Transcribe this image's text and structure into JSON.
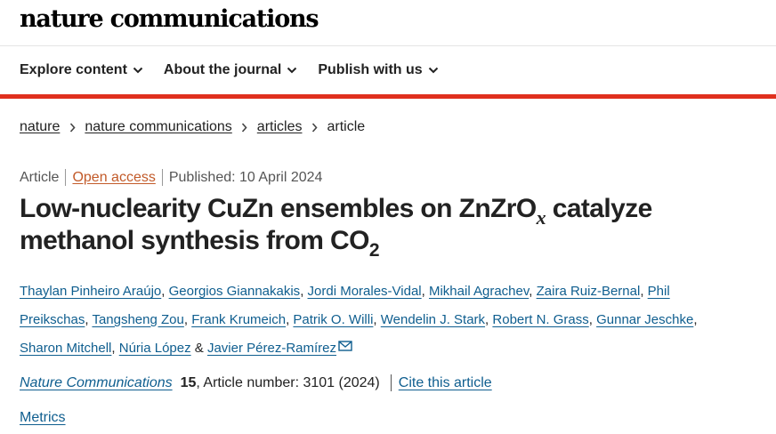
{
  "site": {
    "brand": "nature communications"
  },
  "nav": {
    "items": [
      {
        "label": "Explore content",
        "icon": "chevron-down-icon"
      },
      {
        "label": "About the journal",
        "icon": "chevron-down-icon"
      },
      {
        "label": "Publish with us",
        "icon": "chevron-down-icon"
      }
    ]
  },
  "colors": {
    "accent_bar": "#e0301e",
    "link": "#0f5e8f",
    "open_access": "#c25a29"
  },
  "breadcrumb": {
    "items": [
      "nature",
      "nature communications",
      "articles"
    ],
    "current": "article",
    "separator_icon": "chevron-right-icon"
  },
  "article": {
    "type": "Article",
    "access": "Open access",
    "published": "Published: 10 April 2024",
    "title": {
      "part1": "Low-nuclearity CuZn ensembles on ZnZrO",
      "var": "x",
      "part2": " catalyze methanol synthesis from CO",
      "sub": "2"
    },
    "authors": [
      "Thaylan Pinheiro Araújo",
      "Georgios Giannakakis",
      "Jordi Morales-Vidal",
      "Mikhail Agrachev",
      "Zaira Ruiz-Bernal",
      "Phil Preikschas",
      "Tangsheng Zou",
      "Frank Krumeich",
      "Patrik O. Willi",
      "Wendelin J. Stark",
      "Robert N. Grass",
      "Gunnar Jeschke",
      "Sharon Mitchell",
      "Núria López",
      "Javier Pérez-Ramírez"
    ],
    "author_separator": ", ",
    "author_and": " & ",
    "corresponding_icon": "envelope-icon"
  },
  "citation": {
    "journal": "Nature Communications",
    "volume": "15",
    "article_number": ", Article number: 3101 (2024)",
    "cite_link": "Cite this article"
  },
  "metrics": {
    "label": "Metrics"
  }
}
